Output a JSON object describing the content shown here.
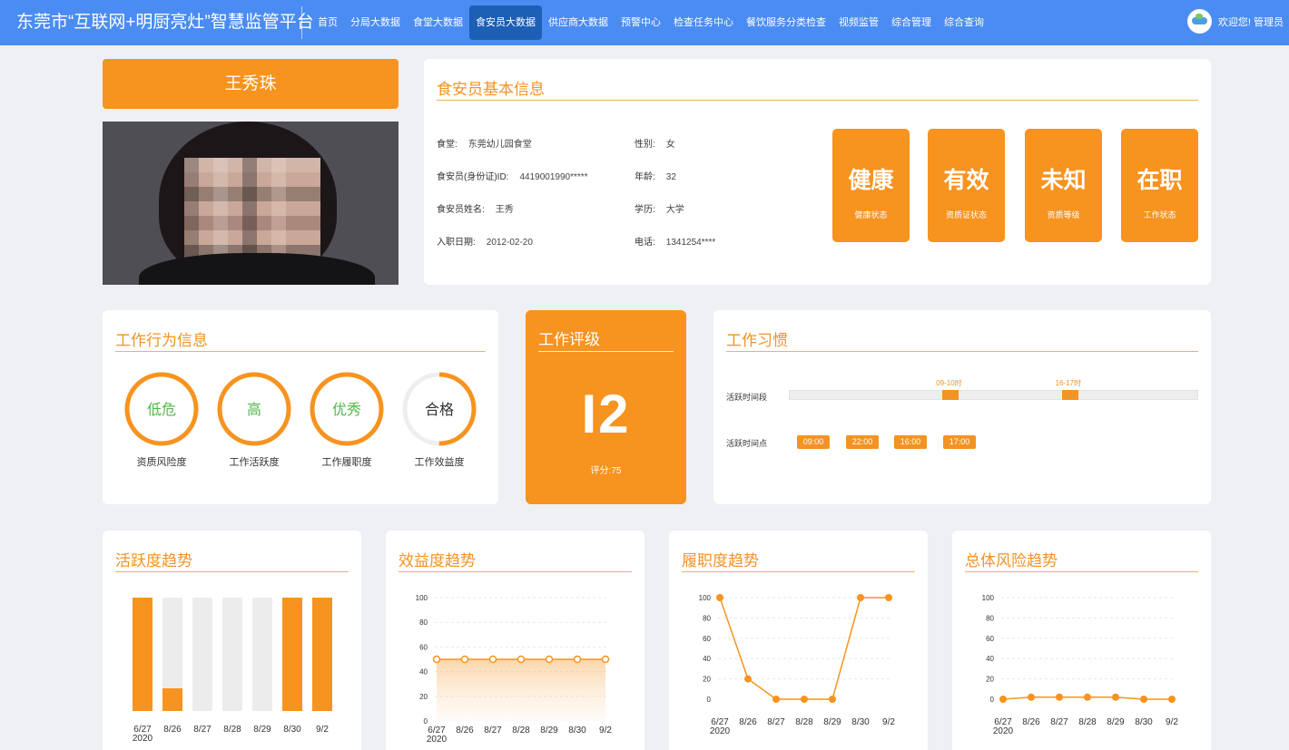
{
  "header": {
    "title": "东莞市“互联网+明厨亮灶”智慧监管平台",
    "nav": [
      "首页",
      "分局大数据",
      "食堂大数据",
      "食安员大数据",
      "供应商大数据",
      "预警中心",
      "检查任务中心",
      "餐饮服务分类检查",
      "视频监管",
      "综合管理",
      "综合查询"
    ],
    "active_nav": "食安员大数据",
    "welcome": "欢迎您! 管理员"
  },
  "profile": {
    "name": "王秀珠"
  },
  "basic_info": {
    "title": "食安员基本信息",
    "fields": [
      {
        "label": "食堂:",
        "value": "东莞幼儿园食堂"
      },
      {
        "label": "性别:",
        "value": "女"
      },
      {
        "label": "食安员(身份证)ID:",
        "value": "4419001990*****"
      },
      {
        "label": "年龄:",
        "value": "32"
      },
      {
        "label": "食安员姓名:",
        "value": "王秀"
      },
      {
        "label": "学历:",
        "value": "大学"
      },
      {
        "label": "入职日期:",
        "value": "2012-02-20"
      },
      {
        "label": "电话:",
        "value": "1341254****"
      }
    ],
    "status_tiles": [
      {
        "value": "健康",
        "label": "健康状态"
      },
      {
        "value": "有效",
        "label": "资质证状态"
      },
      {
        "value": "未知",
        "label": "资质等级"
      },
      {
        "value": "在职",
        "label": "工作状态"
      }
    ]
  },
  "behavior": {
    "title": "工作行为信息",
    "rings": [
      {
        "value": "低危",
        "label": "资质风险度",
        "fraction": 1.0,
        "color": "#55b64a"
      },
      {
        "value": "高",
        "label": "工作活跃度",
        "fraction": 1.0,
        "color": "#55b64a"
      },
      {
        "value": "优秀",
        "label": "工作履职度",
        "fraction": 1.0,
        "color": "#55b64a"
      },
      {
        "value": "合格",
        "label": "工作效益度",
        "fraction": 0.5,
        "color": "#333333"
      }
    ]
  },
  "rating": {
    "title": "工作评级",
    "grade": "I2",
    "score": "评分:75"
  },
  "habits": {
    "title": "工作习惯",
    "period_label": "活跃时间段",
    "point_label": "活跃时间点",
    "periods": [
      {
        "label": "09-10时",
        "start_hour": 9
      },
      {
        "label": "16-17时",
        "start_hour": 16
      }
    ],
    "points": [
      "09:00",
      "22:00",
      "16:00",
      "17:00"
    ]
  },
  "colors": {
    "accent": "#f7931f",
    "header": "#4a8cf2",
    "ring_text": "#55b64a",
    "background": "#eff0f4"
  },
  "chart_data": [
    {
      "type": "bar",
      "title": "活跃度趋势",
      "categories": [
        "6/27\n2020",
        "8/26",
        "8/27",
        "8/28",
        "8/29",
        "8/30",
        "9/2"
      ],
      "values": [
        100,
        20,
        0,
        0,
        0,
        100,
        100
      ],
      "ylim": [
        0,
        100
      ]
    },
    {
      "type": "area",
      "title": "效益度趋势",
      "categories": [
        "6/27\n2020",
        "8/26",
        "8/27",
        "8/28",
        "8/29",
        "8/30",
        "9/2"
      ],
      "values": [
        50,
        50,
        50,
        50,
        50,
        50,
        50
      ],
      "yticks": [
        0,
        20,
        40,
        60,
        80,
        100
      ],
      "ylim": [
        0,
        100
      ]
    },
    {
      "type": "line",
      "title": "履职度趋势",
      "categories": [
        "6/27\n2020",
        "8/26",
        "8/27",
        "8/28",
        "8/29",
        "8/30",
        "9/2"
      ],
      "values": [
        100,
        20,
        0,
        0,
        0,
        100,
        100
      ],
      "yticks": [
        0,
        20,
        40,
        60,
        80,
        100
      ],
      "ylim": [
        0,
        100
      ]
    },
    {
      "type": "line",
      "title": "总体风险趋势",
      "categories": [
        "6/27\n2020",
        "8/26",
        "8/27",
        "8/28",
        "8/29",
        "8/30",
        "9/2"
      ],
      "values": [
        0,
        2,
        2,
        2,
        2,
        0,
        0
      ],
      "yticks": [
        0,
        20,
        40,
        60,
        80,
        100
      ],
      "ylim": [
        0,
        100
      ]
    }
  ]
}
